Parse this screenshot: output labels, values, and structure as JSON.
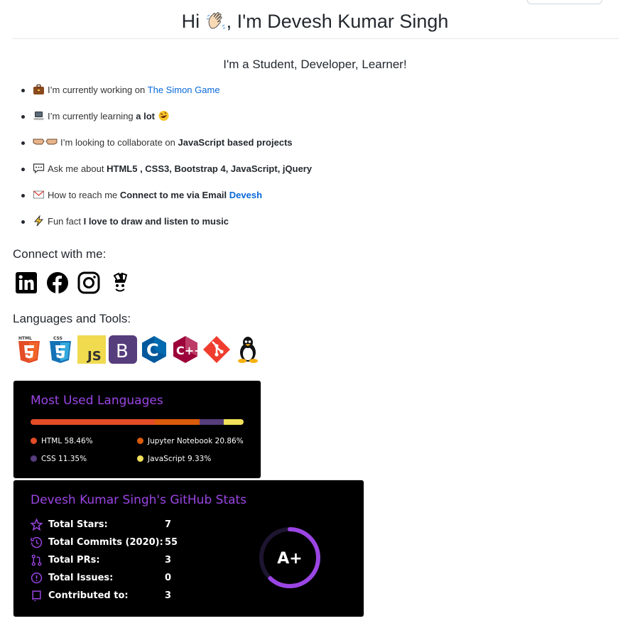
{
  "header": {
    "title_prefix": "Hi",
    "title_suffix": ", I'm Devesh Kumar Singh",
    "wave_icon": "waving-hand-icon"
  },
  "subtitle": "I'm a Student, Developer, Learner!",
  "bullets": {
    "working": {
      "icon": "briefcase-icon",
      "text": "I’m currently working on",
      "link": "The Simon Game"
    },
    "learning": {
      "icon": "laptop-icon",
      "text": "I’m currently learning",
      "bold": "a lot",
      "tail_icon": "rofl-icon"
    },
    "collab": {
      "icon": "handshake-icon",
      "text": "I’m looking to collaborate on",
      "bold": "JavaScript based projects"
    },
    "ask": {
      "icon": "speech-bubble-icon",
      "text": "Ask me about",
      "bold": "HTML5 , CSS3, Bootstrap 4, JavaScript, jQuery"
    },
    "reach": {
      "icon": "email-icon",
      "text": "How to reach me",
      "bold": "Connect to me via Email",
      "link": "Devesh"
    },
    "fun": {
      "icon": "lightning-icon",
      "text": "Fun fact",
      "bold": "I love to draw and listen to music"
    }
  },
  "connect": {
    "heading": "Connect with me:",
    "icons": [
      "linkedin-icon",
      "facebook-icon",
      "instagram-icon",
      "kaggle-icon"
    ]
  },
  "tools": {
    "heading": "Languages and Tools:",
    "icons": [
      "html5-icon",
      "css3-icon",
      "javascript-icon",
      "bootstrap-icon",
      "c-icon",
      "cplusplus-icon",
      "git-icon",
      "linux-icon"
    ],
    "labels": {
      "html": "HTML",
      "css": "CSS",
      "js": "JS",
      "bootstrap": "B",
      "c": "C",
      "cpp": "C++"
    }
  },
  "languages_card": {
    "title": "Most Used Languages",
    "items": [
      {
        "name": "HTML",
        "percent": "58.46%",
        "value": 58.46,
        "color": "#e34c26"
      },
      {
        "name": "Jupyter Notebook",
        "percent": "20.86%",
        "value": 20.86,
        "color": "#da5b0b"
      },
      {
        "name": "CSS",
        "percent": "11.35%",
        "value": 11.35,
        "color": "#563d7c"
      },
      {
        "name": "JavaScript",
        "percent": "9.33%",
        "value": 9.33,
        "color": "#f1e05a"
      }
    ]
  },
  "stats_card": {
    "title": "Devesh Kumar Singh's GitHub Stats",
    "rows": [
      {
        "label": "Total Stars:",
        "value": "7",
        "icon": "star-icon"
      },
      {
        "label": "Total Commits (2020):",
        "value": "55",
        "icon": "history-icon"
      },
      {
        "label": "Total PRs:",
        "value": "3",
        "icon": "pull-request-icon"
      },
      {
        "label": "Total Issues:",
        "value": "0",
        "icon": "issue-icon"
      },
      {
        "label": "Contributed to:",
        "value": "3",
        "icon": "repo-icon"
      }
    ],
    "grade": "A+",
    "grade_progress": 0.62,
    "accent": "#9b45e4"
  }
}
